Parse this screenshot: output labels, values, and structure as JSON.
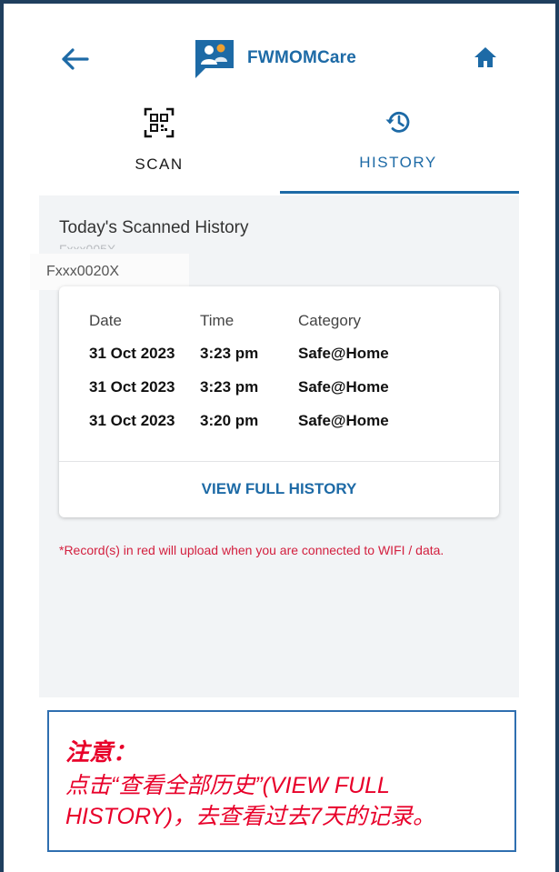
{
  "header": {
    "app_title": "FWMOMCare",
    "back_icon": "arrow-left-icon",
    "home_icon": "home-icon",
    "logo_icon": "chat-people-logo-icon"
  },
  "tabs": [
    {
      "label": "SCAN",
      "icon": "qr-code-icon",
      "active": false
    },
    {
      "label": "HISTORY",
      "icon": "history-clock-icon",
      "active": true
    }
  ],
  "history": {
    "title": "Today's Scanned History",
    "ghost_id": "Fxxx005X",
    "id_mask": "Fxxx0020X",
    "columns": [
      "Date",
      "Time",
      "Category"
    ],
    "rows": [
      {
        "date": "31 Oct 2023",
        "time": "3:23 pm",
        "category": "Safe@Home"
      },
      {
        "date": "31 Oct 2023",
        "time": "3:23 pm",
        "category": "Safe@Home"
      },
      {
        "date": "31 Oct 2023",
        "time": "3:20 pm",
        "category": "Safe@Home"
      }
    ],
    "view_full_label": "VIEW FULL HISTORY",
    "upload_note": "*Record(s) in red will upload when you are connected to WIFI / data."
  },
  "annotation": {
    "heading": "注意：",
    "body": "点击“查看全部历史”(VIEW FULL HISTORY)，去查看过去7天的记录。"
  },
  "colors": {
    "accent": "#1d6aa6",
    "border": "#1f3f5e",
    "red_note": "#d3203f",
    "annotation_red": "#e8002a"
  }
}
